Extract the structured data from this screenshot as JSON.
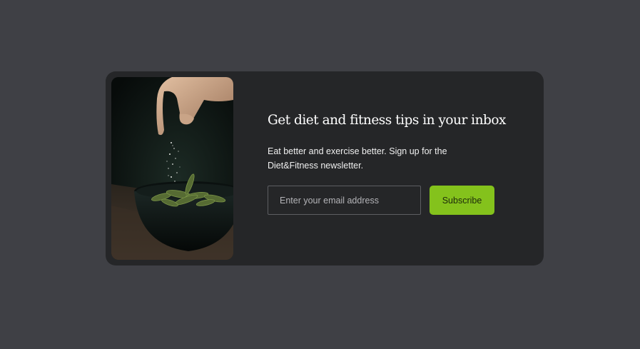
{
  "newsletter": {
    "title": "Get diet and fitness tips in your inbox",
    "description": "Eat better and exercise better. Sign up for the Diet&Fitness newsletter.",
    "email_placeholder": "Enter your email address",
    "email_value": "",
    "subscribe_label": "Subscribe",
    "accent_color": "#84c21c",
    "card_color": "#252628",
    "page_background": "#3f4045"
  }
}
